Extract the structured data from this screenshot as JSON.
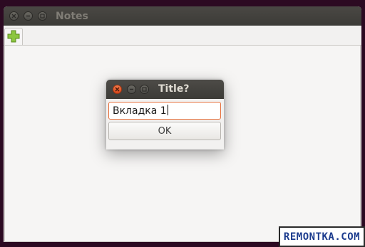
{
  "main_window": {
    "title": "Notes",
    "add_tab_icon": "plus-icon",
    "colors": {
      "titlebar": "#3c3b37",
      "title_text": "#807d76",
      "plus_icon": "#7ab630"
    }
  },
  "dialog": {
    "title": "Title?",
    "input_value": "Вкладка 1",
    "ok_label": "OK",
    "colors": {
      "close_button": "#e2572a",
      "input_border": "#e5703c"
    }
  },
  "watermark": {
    "text": "REMONTKA.COM"
  }
}
